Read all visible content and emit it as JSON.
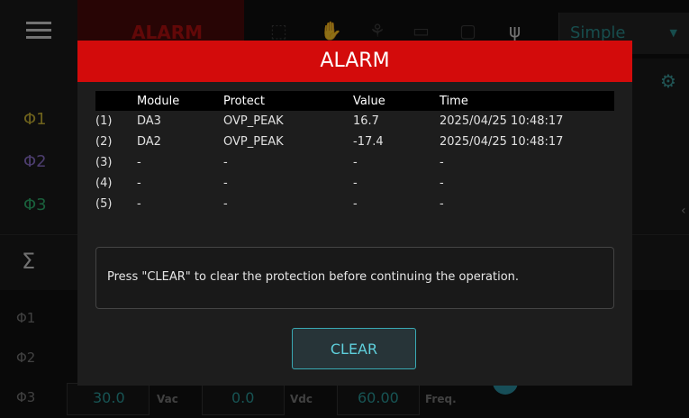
{
  "topbar": {
    "alarm_tab_label": "ALARM",
    "mode_value": "Simple"
  },
  "phases": {
    "p1": "Φ1",
    "p2": "Φ2",
    "p3": "Φ3",
    "sum": "Σ"
  },
  "bottom": {
    "rows": [
      "Φ1",
      "Φ2",
      "Φ3"
    ],
    "vac_value": "30.0",
    "vac_unit": "Vac",
    "vdc_value": "0.0",
    "vdc_unit": "Vdc",
    "freq_value": "60.00",
    "freq_unit": "Freq."
  },
  "colors": {
    "alarm_red": "#d30b0b",
    "accent_teal": "#2a8d8d",
    "phase1": "#c9b233",
    "phase2": "#8a6fc9",
    "phase3": "#2fae6c"
  },
  "dialog": {
    "title": "ALARM",
    "columns": [
      "",
      "Module",
      "Protect",
      "Value",
      "Time"
    ],
    "rows": [
      [
        "(1)",
        "DA3",
        "OVP_PEAK",
        "16.7",
        "2025/04/25 10:48:17"
      ],
      [
        "(2)",
        "DA2",
        "OVP_PEAK",
        "-17.4",
        "2025/04/25 10:48:17"
      ],
      [
        "(3)",
        "-",
        "-",
        "-",
        "-"
      ],
      [
        "(4)",
        "-",
        "-",
        "-",
        "-"
      ],
      [
        "(5)",
        "-",
        "-",
        "-",
        "-"
      ]
    ],
    "message": "Press \"CLEAR\" to clear the protection before continuing the operation.",
    "clear_label": "CLEAR"
  }
}
